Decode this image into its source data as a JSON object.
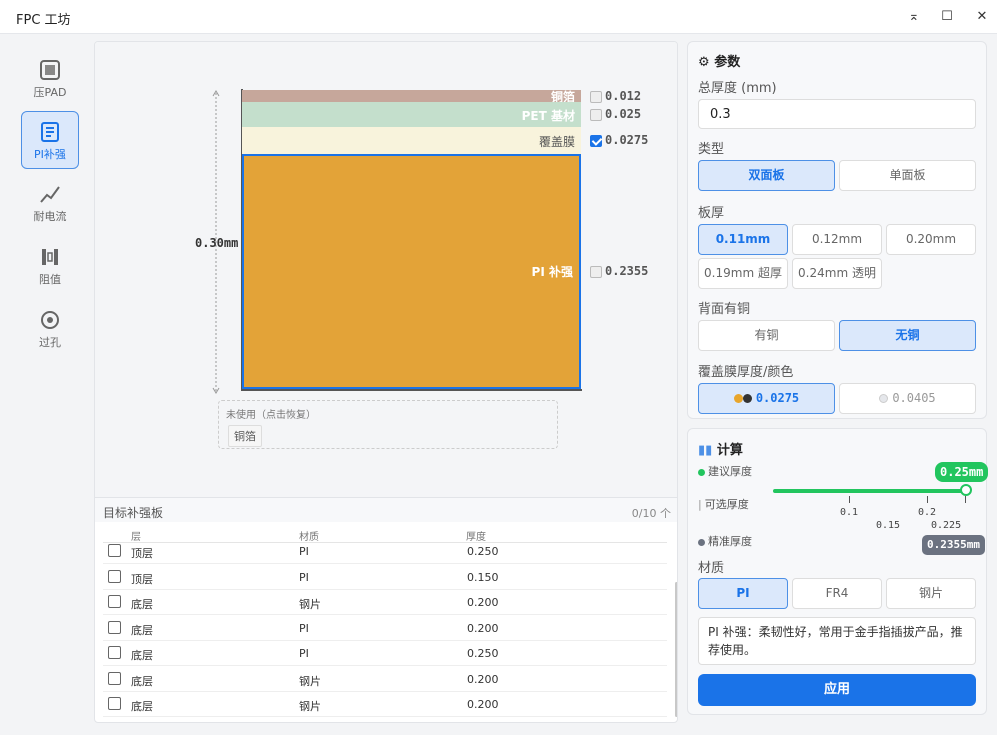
{
  "window": {
    "title": "FPC 工坊",
    "min": "⌅",
    "max": "☐",
    "close": "✕"
  },
  "sidebar": [
    {
      "label": "压PAD",
      "icon": "pad-icon"
    },
    {
      "label": "PI补强",
      "icon": "document-icon",
      "active": true
    },
    {
      "label": "耐电流",
      "icon": "trend-icon"
    },
    {
      "label": "阻值",
      "icon": "resistor-icon"
    },
    {
      "label": "过孔",
      "icon": "via-icon"
    }
  ],
  "stack": {
    "total_label": "0.30mm",
    "layers": [
      {
        "name": "铜箔",
        "thickness": "0.012",
        "color": "#c6a79b",
        "checked": false
      },
      {
        "name": "PET 基材",
        "thickness": "0.025",
        "color": "#c4dfcc",
        "checked": false
      },
      {
        "name": "覆盖膜",
        "thickness": "0.0275",
        "color": "#f8f3dc",
        "checked": true
      },
      {
        "name": "PI 补强",
        "thickness": "0.2355",
        "color": "#e3a338",
        "checked": false
      }
    ],
    "unused_title": "未使用（点击恢复）",
    "unused_chip": "铜箔"
  },
  "table": {
    "title": "目标补强板",
    "count": "0/10 个",
    "columns": [
      "层",
      "材质",
      "厚度"
    ],
    "rows": [
      [
        "顶层",
        "PI",
        "0.250"
      ],
      [
        "顶层",
        "PI",
        "0.150"
      ],
      [
        "底层",
        "钢片",
        "0.200"
      ],
      [
        "底层",
        "PI",
        "0.200"
      ],
      [
        "底层",
        "PI",
        "0.250"
      ],
      [
        "底层",
        "钢片",
        "0.200"
      ],
      [
        "底层",
        "钢片",
        "0.200"
      ]
    ]
  },
  "params": {
    "title": "参数",
    "total_label": "总厚度 (mm)",
    "total_value": "0.3",
    "type_label": "类型",
    "type_options": [
      "双面板",
      "单面板"
    ],
    "board_label": "板厚",
    "board_options": [
      "0.11mm",
      "0.12mm",
      "0.20mm",
      "0.19mm 超厚",
      "0.24mm 透明"
    ],
    "back_label": "背面有铜",
    "back_options": [
      "有铜",
      "无铜"
    ],
    "cover_label": "覆盖膜厚度/颜色",
    "cover_options": [
      "0.0275",
      "0.0405"
    ],
    "colors": {
      "accent": "#1a73e8",
      "green": "#22c55e",
      "gray": "#6b7280"
    }
  },
  "calc": {
    "title": "计算",
    "legend_suggest": "建议厚度",
    "legend_optional": "可选厚度",
    "legend_precise": "精准厚度",
    "badge_top": "0.25mm",
    "badge_bottom": "0.2355mm",
    "ticks": [
      "0.1",
      "0.15",
      "0.2",
      "0.225"
    ],
    "slider_value": 0.25,
    "material_label": "材质",
    "material_options": [
      "PI",
      "FR4",
      "钢片"
    ],
    "description": "PI 补强：柔韧性好，常用于金手指插拔产品，推荐使用。",
    "apply": "应用"
  }
}
